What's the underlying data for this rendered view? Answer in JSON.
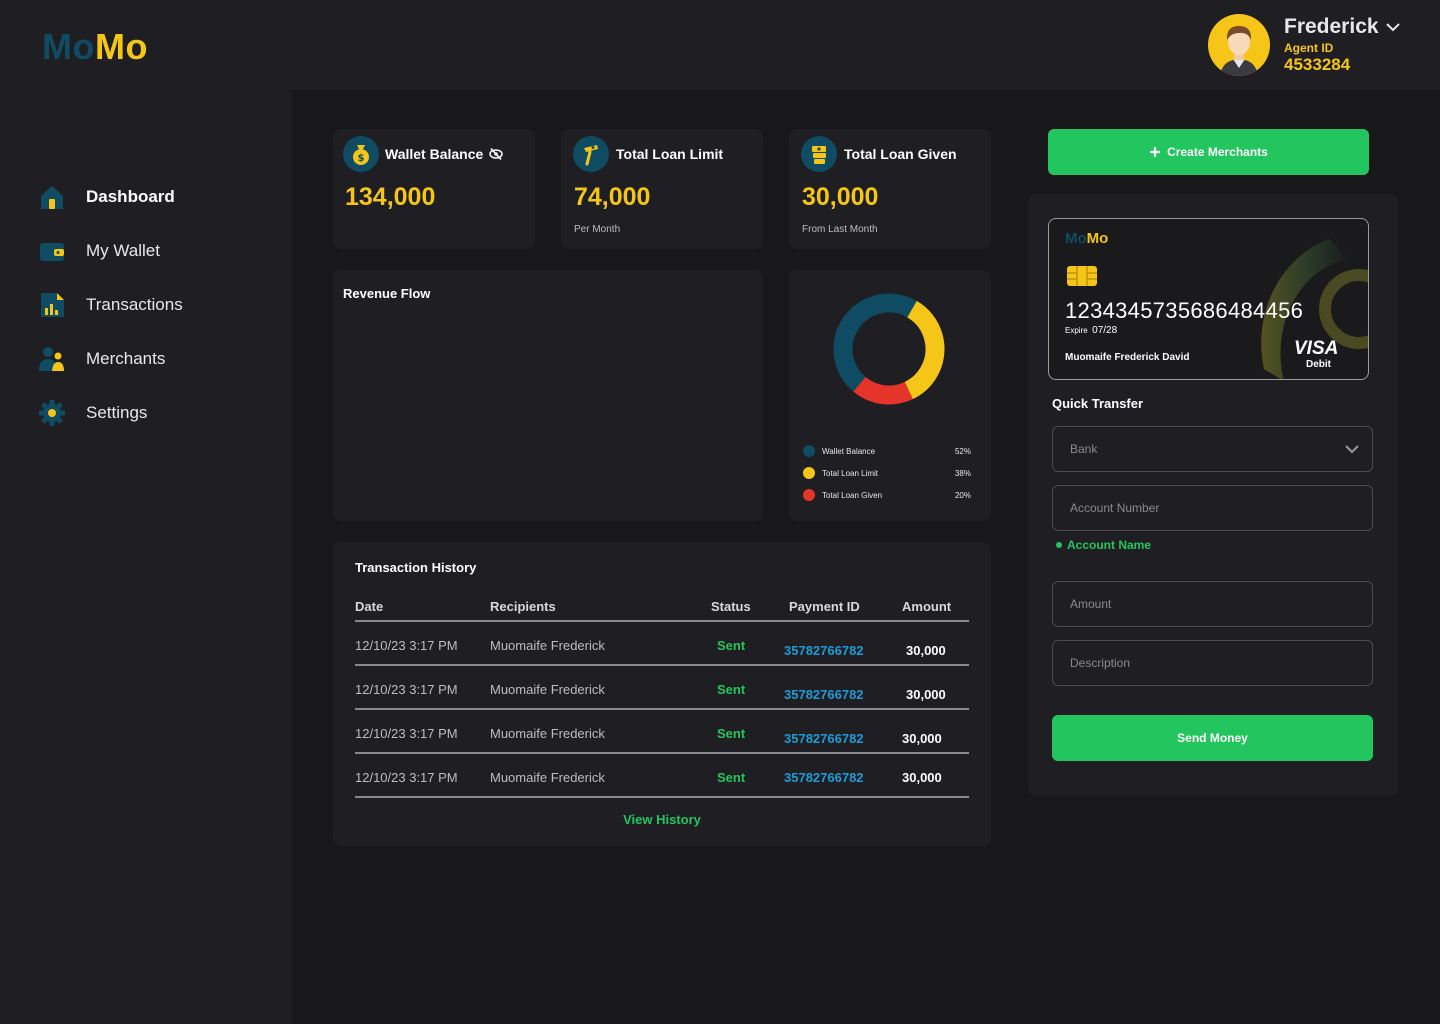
{
  "brand": {
    "part1": "Mo",
    "part2": "Mo"
  },
  "profile": {
    "name": "Frederick",
    "agent_label": "Agent ID",
    "agent_id": "4533284"
  },
  "nav": [
    {
      "label": "Dashboard",
      "icon": "home-icon"
    },
    {
      "label": "My Wallet",
      "icon": "wallet-icon"
    },
    {
      "label": "Transactions",
      "icon": "bar-chart-icon"
    },
    {
      "label": "Merchants",
      "icon": "users-icon"
    },
    {
      "label": "Settings",
      "icon": "gear-icon"
    }
  ],
  "stats": [
    {
      "title": "Wallet Balance",
      "value": "134,000",
      "sub": "",
      "icon": "money-bag-icon"
    },
    {
      "title": "Total Loan Limit",
      "value": "74,000",
      "sub": "Per Month",
      "icon": "hand-money-icon"
    },
    {
      "title": "Total Loan Given",
      "value": "30,000",
      "sub": "From Last Month",
      "icon": "cash-stack-icon"
    }
  ],
  "revenue": {
    "title": "Revenue Flow"
  },
  "chart_data": {
    "type": "pie",
    "categories": [
      "Wallet Balance",
      "Total Loan Limit",
      "Total Loan Given"
    ],
    "values": [
      52,
      38,
      20
    ],
    "labels": [
      "52%",
      "38%",
      "20%"
    ],
    "colors": [
      "#0f4c63",
      "#f5c518",
      "#e5342a"
    ],
    "legend": "bottom"
  },
  "transactions": {
    "title": "Transaction History",
    "headers": [
      "Date",
      "Recipients",
      "Status",
      "Payment ID",
      "Amount"
    ],
    "rows": [
      {
        "date": "12/10/23  3:17 PM",
        "recipient": "Muomaife Frederick",
        "status": "Sent",
        "pid": "35782766782",
        "amount": "30,000"
      },
      {
        "date": "12/10/23  3:17 PM",
        "recipient": "Muomaife Frederick",
        "status": "Sent",
        "pid": "35782766782",
        "amount": "30,000"
      },
      {
        "date": "12/10/23  3:17 PM",
        "recipient": "Muomaife Frederick",
        "status": "Sent",
        "pid": "35782766782",
        "amount": "30,000"
      },
      {
        "date": "12/10/23  3:17 PM",
        "recipient": "Muomaife Frederick",
        "status": "Sent",
        "pid": "35782766782",
        "amount": "30,000"
      }
    ],
    "view_history": "View History"
  },
  "create_merchants": "Create Merchants",
  "card": {
    "brand1": "Mo",
    "brand2": "Mo",
    "number": "1234345735686484456",
    "expire_label": "Expire",
    "expire": "07/28",
    "holder": "Muomaife Frederick David",
    "network": "VISA",
    "type": "Debit"
  },
  "quick_transfer": {
    "title": "Quick Transfer",
    "bank_placeholder": "Bank",
    "account_number_placeholder": "Account Number",
    "account_name": "Account Name",
    "amount_placeholder": "Amount",
    "description_placeholder": "Description",
    "send_label": "Send Money"
  }
}
